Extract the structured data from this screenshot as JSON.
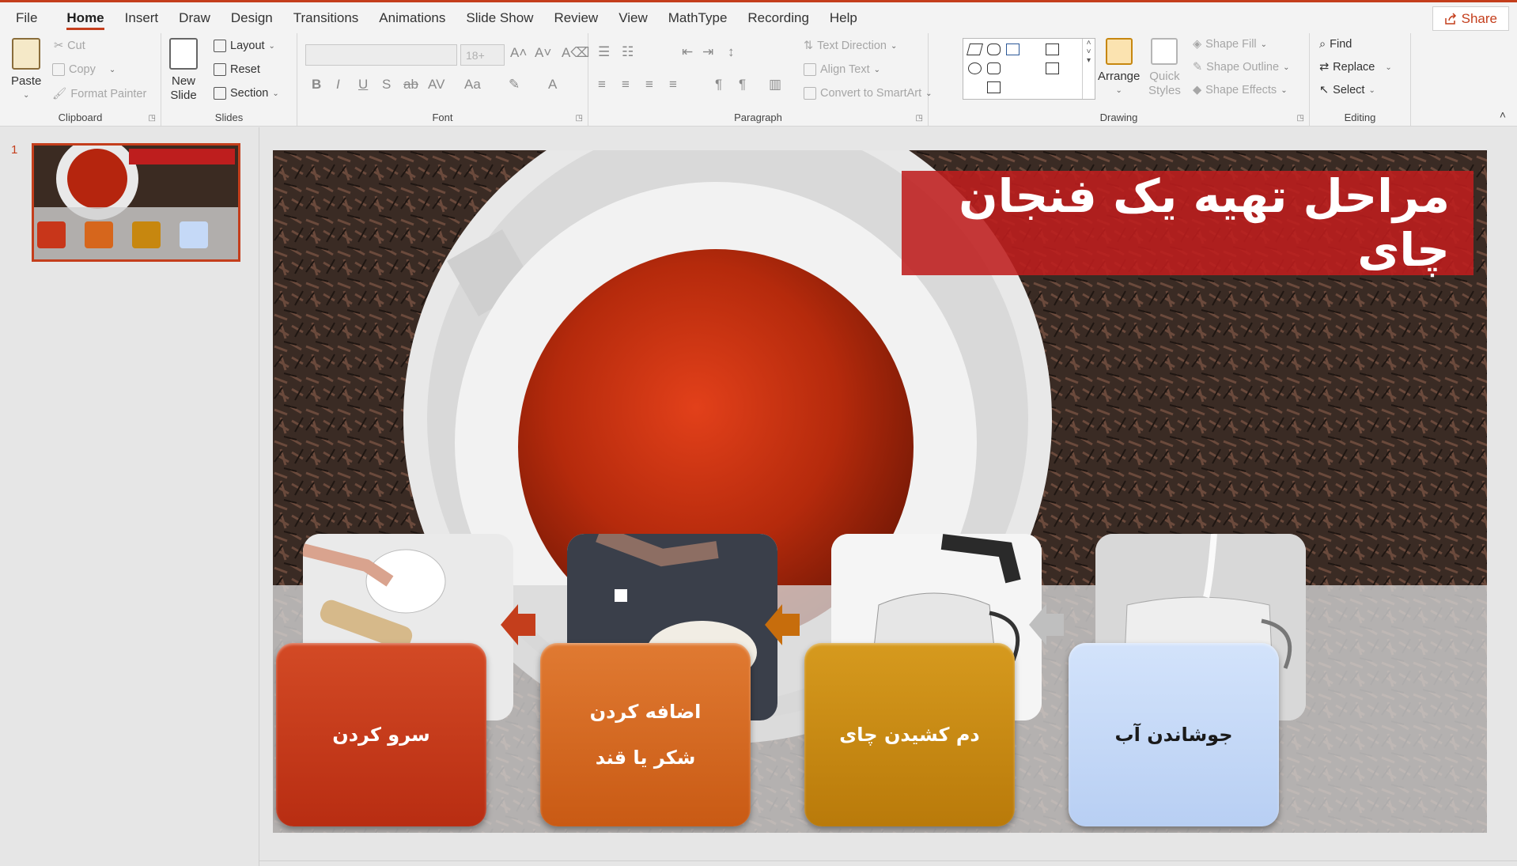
{
  "menu": {
    "items": [
      "File",
      "Home",
      "Insert",
      "Draw",
      "Design",
      "Transitions",
      "Animations",
      "Slide Show",
      "Review",
      "View",
      "MathType",
      "Recording",
      "Help"
    ],
    "active": "Home",
    "share_label": "Share"
  },
  "ribbon": {
    "clipboard": {
      "label": "Clipboard",
      "paste": "Paste",
      "cut": "Cut",
      "copy": "Copy",
      "format_painter": "Format Painter"
    },
    "slides": {
      "label": "Slides",
      "new_slide_line1": "New",
      "new_slide_line2": "Slide",
      "layout": "Layout",
      "reset": "Reset",
      "section": "Section"
    },
    "font": {
      "label": "Font",
      "size": "18+"
    },
    "paragraph": {
      "label": "Paragraph",
      "text_direction": "Text Direction",
      "align_text": "Align Text",
      "convert_smartart": "Convert to SmartArt"
    },
    "drawing": {
      "label": "Drawing",
      "arrange": "Arrange",
      "quick_styles_line1": "Quick",
      "quick_styles_line2": "Styles",
      "shape_fill": "Shape Fill",
      "shape_outline": "Shape Outline",
      "shape_effects": "Shape Effects"
    },
    "editing": {
      "label": "Editing",
      "find": "Find",
      "replace": "Replace",
      "select": "Select"
    }
  },
  "thumbnails": [
    {
      "number": "1",
      "title": "مراحل تهیه یک فنجان چای"
    }
  ],
  "slide": {
    "title": "مراحل تهیه یک فنجان چای",
    "steps": [
      {
        "label": "جوشاندن آب",
        "color": "#c5d9f7",
        "text_color": "#1a1a1a"
      },
      {
        "label": "دم کشیدن چای",
        "color": "#c7870f",
        "text_color": "#ffffff"
      },
      {
        "label_line1": "اضافه کردن",
        "label_line2": "شکر یا قند",
        "color": "#d6661c",
        "text_color": "#ffffff"
      },
      {
        "label": "سرو کردن",
        "color": "#c8361a",
        "text_color": "#ffffff"
      }
    ],
    "colors": {
      "title_bg": "#be1e1e",
      "arrow_1": "#bfbfbf",
      "arrow_2": "#c76d0c",
      "arrow_3": "#c43e1c"
    }
  }
}
